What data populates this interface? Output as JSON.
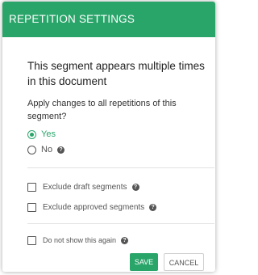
{
  "dialog": {
    "header": "REPETITION SETTINGS",
    "title": "This segment appears multiple times in this document",
    "question": "Apply changes to all repetitions of this segment?",
    "options": [
      {
        "label": "Yes",
        "selected": true
      },
      {
        "label": "No",
        "selected": false
      }
    ],
    "checkboxes": [
      {
        "label": "Exclude draft segments",
        "checked": false
      },
      {
        "label": "Exclude approved segments",
        "checked": false
      },
      {
        "label": "Do not show this again",
        "checked": false
      }
    ],
    "help_glyph": "?",
    "buttons": {
      "save": "SAVE",
      "cancel": "CANCEL"
    }
  },
  "colors": {
    "accent": "#2aa56a",
    "text": "#222222",
    "muted": "#555555"
  },
  "icons": {
    "help": "help-circle-icon",
    "radio": "radio-button",
    "checkbox": "checkbox"
  }
}
